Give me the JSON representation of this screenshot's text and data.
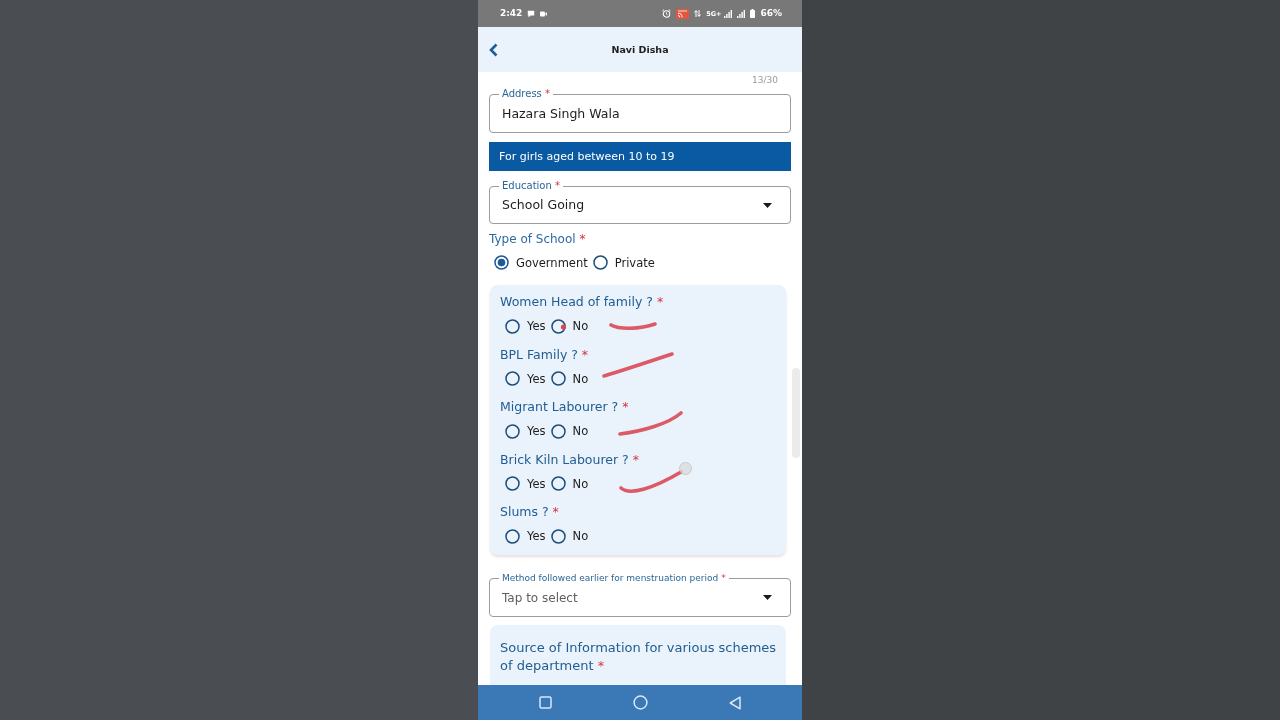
{
  "status_bar": {
    "time": "2:42",
    "network": "5G+",
    "battery": "66%"
  },
  "app_bar": {
    "title": "Navi Disha"
  },
  "form": {
    "address": {
      "counter": "13/30",
      "label": "Address",
      "required_mark": "*",
      "value": "Hazara Singh Wala"
    },
    "banner": "For girls aged between 10 to 19",
    "education": {
      "label": "Education",
      "required_mark": "*",
      "value": "School Going"
    },
    "type_of_school": {
      "label": "Type of School",
      "required_mark": "*",
      "options": [
        {
          "label": "Government",
          "selected": true
        },
        {
          "label": "Private",
          "selected": false
        }
      ]
    },
    "questions": [
      {
        "label": "Women Head of family ?",
        "required_mark": "*",
        "options": [
          {
            "label": "Yes",
            "selected": false
          },
          {
            "label": "No",
            "selected": false
          }
        ]
      },
      {
        "label": "BPL Family ?",
        "required_mark": "*",
        "options": [
          {
            "label": "Yes",
            "selected": false
          },
          {
            "label": "No",
            "selected": false
          }
        ]
      },
      {
        "label": "Migrant Labourer ?",
        "required_mark": "*",
        "options": [
          {
            "label": "Yes",
            "selected": false
          },
          {
            "label": "No",
            "selected": false
          }
        ]
      },
      {
        "label": "Brick Kiln Labourer ?",
        "required_mark": "*",
        "options": [
          {
            "label": "Yes",
            "selected": false
          },
          {
            "label": "No",
            "selected": false
          }
        ]
      },
      {
        "label": "Slums ?",
        "required_mark": "*",
        "options": [
          {
            "label": "Yes",
            "selected": false
          },
          {
            "label": "No",
            "selected": false
          }
        ]
      }
    ],
    "method": {
      "label": "Method followed earlier for menstruation period",
      "required_mark": "*",
      "placeholder": "Tap to select"
    },
    "source": {
      "label": "Source of Information for various schemes of department",
      "required_mark": "*"
    }
  }
}
